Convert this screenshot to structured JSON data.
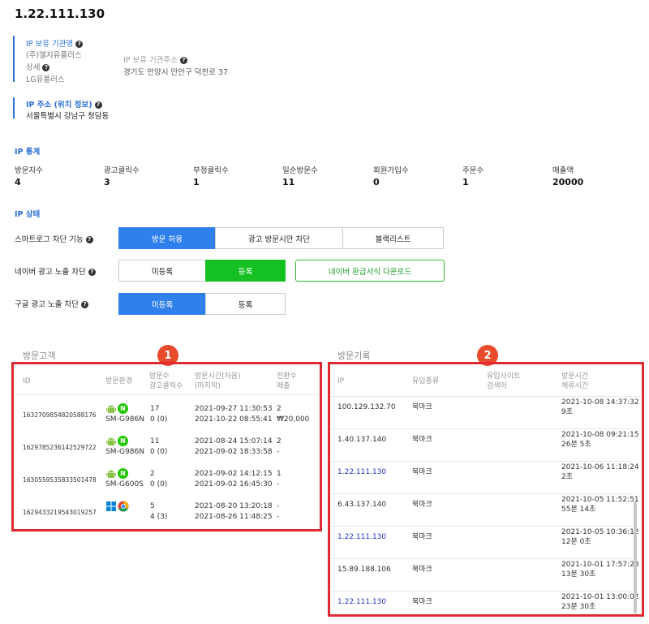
{
  "page_title": "1.22.111.130",
  "org": {
    "name_label": "IP 보유 기관명",
    "name_value": "(주)엘지유플러스",
    "detail_label": "상세",
    "detail_value": "LG유플러스",
    "addr_label": "IP 보유 기관주소",
    "addr_value": "경기도 안양시 만안구 덕천로 37"
  },
  "location": {
    "label": "IP 주소 (위치 정보)",
    "value": "서울특별시 강남구 청담동"
  },
  "stats": {
    "title": "IP 통계",
    "items": [
      {
        "label": "방문자수",
        "value": "4"
      },
      {
        "label": "광고클릭수",
        "value": "3"
      },
      {
        "label": "부정클릭수",
        "value": "1"
      },
      {
        "label": "일순방문수",
        "value": "11"
      },
      {
        "label": "회원가입수",
        "value": "0"
      },
      {
        "label": "주문수",
        "value": "1"
      },
      {
        "label": "매출액",
        "value": "20000"
      }
    ]
  },
  "status": {
    "title": "IP 상태",
    "smartlog_label": "스마트로그 차단 기능",
    "smartlog_buttons": [
      "방문 허용",
      "광고 방문시만 차단",
      "블랙리스트"
    ],
    "naver_label": "네이버 광고 노출 차단",
    "naver_buttons": [
      "미등록",
      "등록"
    ],
    "naver_download": "네이버 환급서식 다운로드",
    "google_label": "구글 광고 노출 차단",
    "google_buttons": [
      "미등록",
      "등록"
    ]
  },
  "visitors": {
    "title": "방문고객",
    "badge": "1",
    "headers": {
      "id": "ID",
      "env": "방문환경",
      "counts": [
        "방문수",
        "광고클릭수"
      ],
      "times": [
        "방문시간(처음)",
        "(마지막)"
      ],
      "conv": [
        "전환수",
        "매출"
      ]
    },
    "rows": [
      {
        "id": "1632709854820588176",
        "device": "SM-G986N",
        "visits": "17",
        "clicks": "0 (0)",
        "first": "2021-09-27 11:30:53",
        "last": "2021-10-22 08:55:41",
        "conv": "2",
        "sales": "₩20,000",
        "icons": [
          "android-icon",
          "naver-icon"
        ]
      },
      {
        "id": "1629785236142529722",
        "device": "SM-G986N",
        "visits": "11",
        "clicks": "0 (0)",
        "first": "2021-08-24 15:07:14",
        "last": "2021-09-02 18:33:58",
        "conv": "2",
        "sales": "-",
        "icons": [
          "android-icon",
          "naver-icon"
        ]
      },
      {
        "id": "1630559535833501478",
        "device": "SM-G600S",
        "visits": "2",
        "clicks": "0 (0)",
        "first": "2021-09-02 14:12:15",
        "last": "2021-09-02 16:45:30",
        "conv": "1",
        "sales": "-",
        "icons": [
          "android-icon",
          "naver-icon"
        ]
      },
      {
        "id": "1629433219543019257",
        "device": "",
        "visits": "5",
        "clicks": "4 (3)",
        "first": "2021-08-20 13:20:18",
        "last": "2021-08-26 11:48:25",
        "conv": "-",
        "sales": "-",
        "icons": [
          "windows-icon",
          "chrome-icon"
        ]
      }
    ]
  },
  "records": {
    "title": "방문기록",
    "badge": "2",
    "headers": {
      "ip": "IP",
      "type": "유입종류",
      "site": [
        "유입사이트",
        "검색어"
      ],
      "time": [
        "방문시간",
        "체류시간"
      ]
    },
    "rows": [
      {
        "ip": "100.129.132.70",
        "type": "북마크",
        "time": "2021-10-08 14:37:32",
        "stay": "9초",
        "link": false
      },
      {
        "ip": "1.40.137.140",
        "type": "북마크",
        "time": "2021-10-08 09:21:15",
        "stay": "26분 5초",
        "link": false
      },
      {
        "ip": "1.22.111.130",
        "type": "북마크",
        "time": "2021-10-06 11:18:24",
        "stay": "2초",
        "link": true
      },
      {
        "ip": "6.43.137.140",
        "type": "북마크",
        "time": "2021-10-05 11:52:51",
        "stay": "55분 14초",
        "link": false
      },
      {
        "ip": "1.22.111.130",
        "type": "북마크",
        "time": "2021-10-05 10:36:12",
        "stay": "12분 0초",
        "link": true
      },
      {
        "ip": "15.89.188.106",
        "type": "북마크",
        "time": "2021-10-01 17:57:23",
        "stay": "13분 30초",
        "link": false
      },
      {
        "ip": "1.22.111.130",
        "type": "북마크",
        "time": "2021-10-01 13:00:02",
        "stay": "23분 30초",
        "link": true
      }
    ]
  },
  "colors": {
    "accent": "#2f80ed",
    "green": "#15c022",
    "annotation_red": "#e02a33"
  }
}
